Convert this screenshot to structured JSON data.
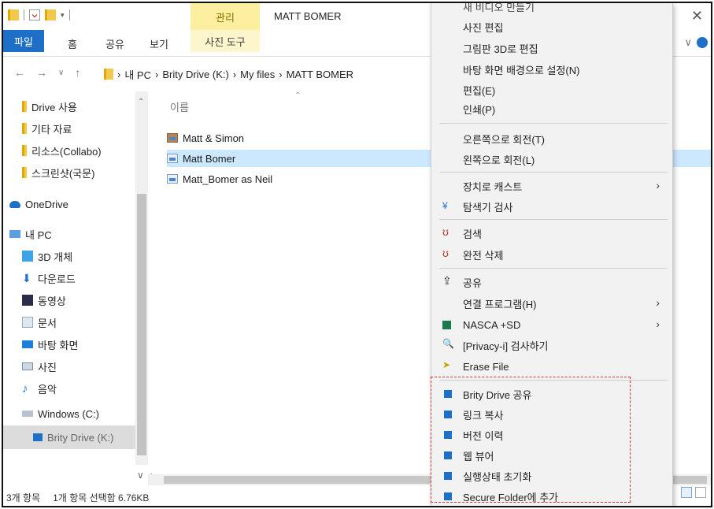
{
  "window": {
    "manage_tab": "관리",
    "title": "MATT BOMER",
    "close": "✕"
  },
  "ribbon": {
    "file_tab": "파일",
    "tabs": [
      "홈",
      "공유",
      "보기"
    ],
    "photo_tools": "사진 도구",
    "expand": "∨"
  },
  "address": {
    "nav_back": "←",
    "nav_forward": "→",
    "nav_recent": "∨",
    "nav_up": "↑",
    "crumbs": [
      "내 PC",
      "Brity Drive (K:)",
      "My files",
      "MATT BOMER"
    ],
    "chevron": "›"
  },
  "navpane": {
    "items": [
      {
        "label": "Drive 사용",
        "icon": "folder-icon"
      },
      {
        "label": "기타 자료",
        "icon": "folder-icon"
      },
      {
        "label": "리소스(Collabo)",
        "icon": "folder-icon"
      },
      {
        "label": "스크린샷(국문)",
        "icon": "folder-icon"
      },
      {
        "label": "OneDrive",
        "icon": "cloud-icon"
      },
      {
        "label": "내 PC",
        "icon": "computer-icon"
      },
      {
        "label": "3D 개체",
        "icon": "cube-icon"
      },
      {
        "label": "다운로드",
        "icon": "download-icon"
      },
      {
        "label": "동영상",
        "icon": "video-icon"
      },
      {
        "label": "문서",
        "icon": "document-icon"
      },
      {
        "label": "바탕 화면",
        "icon": "desktop-icon"
      },
      {
        "label": "사진",
        "icon": "pictures-icon"
      },
      {
        "label": "음악",
        "icon": "music-icon"
      },
      {
        "label": "Windows (C:)",
        "icon": "drive-icon"
      },
      {
        "label": "Brity Drive (K:)",
        "icon": "cloud-drive-icon"
      }
    ]
  },
  "content": {
    "column_name": "이름",
    "files": [
      {
        "name": "Matt & Simon",
        "selected": false
      },
      {
        "name": "Matt Bomer",
        "selected": true
      },
      {
        "name": "Matt_Bomer as Neil",
        "selected": false
      }
    ]
  },
  "status": {
    "count": "3개 항목",
    "selection": "1개 항목 선택함 6.76KB"
  },
  "context_menu": {
    "items": [
      {
        "label": "새 비디오 만들기",
        "icon": ""
      },
      {
        "label": "사진 편집",
        "icon": ""
      },
      {
        "label": "그림판 3D로 편집",
        "icon": ""
      },
      {
        "label": "바탕 화면 배경으로 설정(N)",
        "icon": ""
      },
      {
        "label": "편집(E)",
        "icon": ""
      },
      {
        "label": "인쇄(P)",
        "icon": ""
      },
      {
        "label": "오른쪽으로 회전(T)",
        "icon": ""
      },
      {
        "label": "왼쪽으로 회전(L)",
        "icon": ""
      },
      {
        "label": "장치로 캐스트",
        "icon": "",
        "submenu": true
      },
      {
        "label": "탐색기 검사",
        "icon": "shield-icon"
      },
      {
        "label": "검색",
        "icon": "v3-icon"
      },
      {
        "label": "완전 삭제",
        "icon": "v3-icon"
      },
      {
        "label": "공유",
        "icon": "share-icon"
      },
      {
        "label": "연결 프로그램(H)",
        "icon": "",
        "submenu": true
      },
      {
        "label": "NASCA +SD",
        "icon": "nasca-icon",
        "submenu": true
      },
      {
        "label": "[Privacy-i] 검사하기",
        "icon": "privacy-icon"
      },
      {
        "label": "Erase File",
        "icon": "erase-icon"
      },
      {
        "label": "Brity Drive 공유",
        "icon": "brity-icon"
      },
      {
        "label": "링크 복사",
        "icon": "brity-icon"
      },
      {
        "label": "버전 이력",
        "icon": "brity-icon"
      },
      {
        "label": "웹 뷰어",
        "icon": "brity-icon"
      },
      {
        "label": "실행상태 초기화",
        "icon": "brity-icon"
      },
      {
        "label": "Secure Folder에 추가",
        "icon": "brity-icon"
      }
    ],
    "submenu_arrow": "›"
  },
  "colors": {
    "file_tab": "#1e6fc8",
    "manage_tab": "#fcef9f",
    "selection": "#cce8ff",
    "highlight_box": "#d0343a"
  }
}
